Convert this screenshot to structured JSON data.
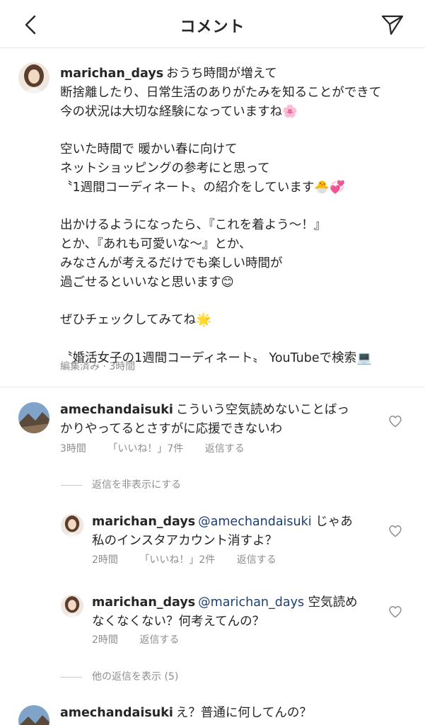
{
  "header": {
    "title": "コメント",
    "back_icon": "chevron-left-icon",
    "send_icon": "paper-plane-icon"
  },
  "caption": {
    "username": "marichan_days",
    "lines": [
      "おうち時間が増えて",
      "断捨離したり、日常生活のありがたみを知ることができて",
      "今の状況は大切な経験になっていますね🌸",
      "",
      "空いた時間で 暖かい春に向けて",
      "ネットショッピングの参考にと思って",
      "〝1週間コーディネート〟の紹介をしています🐣💞",
      "",
      "出かけるようになったら、『これを着よう〜！』",
      "とか、『あれも可愛いな〜』とか、",
      "みなさんが考えるだけでも楽しい時間が",
      "過ごせるといいなと思います😊",
      "",
      "ぜひチェックしてみてね🌟",
      "",
      "〝婚活女子の1週間コーディネート〟 YouTubeで検索💻"
    ],
    "meta": "編集済み · 3時間"
  },
  "comments": [
    {
      "username": "amechandaisuki",
      "line1": "こういう空気読めないことばっ",
      "line2": "かりやってるとさすがに応援できないわ",
      "time": "3時間",
      "likes": "「いいね！」7件",
      "reply": "返信する"
    },
    {
      "username": "marichan_days",
      "mention": "@amechandaisuki",
      "line1_after": "じゃあ",
      "line2": "私のインスタアカウント消すよ？",
      "time": "2時間",
      "likes": "「いいね！」2件",
      "reply": "返信する"
    },
    {
      "username": "marichan_days",
      "mention": "@marichan_days",
      "line1_after": "空気読め",
      "line2": "なくなくない？何考えてんの？",
      "time": "2時間",
      "reply": "返信する"
    },
    {
      "username": "amechandaisuki",
      "line1": "え？普通に何してんの？"
    }
  ],
  "replies": {
    "hide": "返信を非表示にする",
    "show_more": "他の返信を表示 (5)"
  },
  "icons": {
    "like": "heart-outline-icon"
  },
  "colors": {
    "text": "#262626",
    "meta": "#8e8e8e",
    "mention": "#1c3f73"
  }
}
